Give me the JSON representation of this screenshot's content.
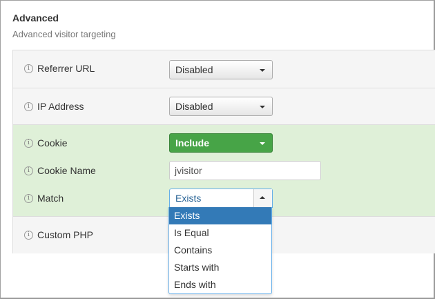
{
  "section": {
    "title": "Advanced",
    "subtitle": "Advanced visitor targeting"
  },
  "fields": {
    "referrer_url": {
      "label": "Referrer URL",
      "value": "Disabled"
    },
    "ip_address": {
      "label": "IP Address",
      "value": "Disabled"
    },
    "cookie": {
      "label": "Cookie",
      "value": "Include"
    },
    "cookie_name": {
      "label": "Cookie Name",
      "value": "jvisitor"
    },
    "match": {
      "label": "Match",
      "value": "Exists"
    },
    "custom_php": {
      "label": "Custom PHP"
    }
  },
  "match_options": [
    "Exists",
    "Is Equal",
    "Contains",
    "Starts with",
    "Ends with"
  ],
  "icons": {
    "info": "info-icon",
    "caret": "caret-down-icon",
    "caret_up": "caret-up-icon"
  },
  "info_glyph": "i",
  "colors": {
    "include_green": "#47a447",
    "highlight_row": "#dff0d8",
    "selected_option": "#337ab7"
  }
}
